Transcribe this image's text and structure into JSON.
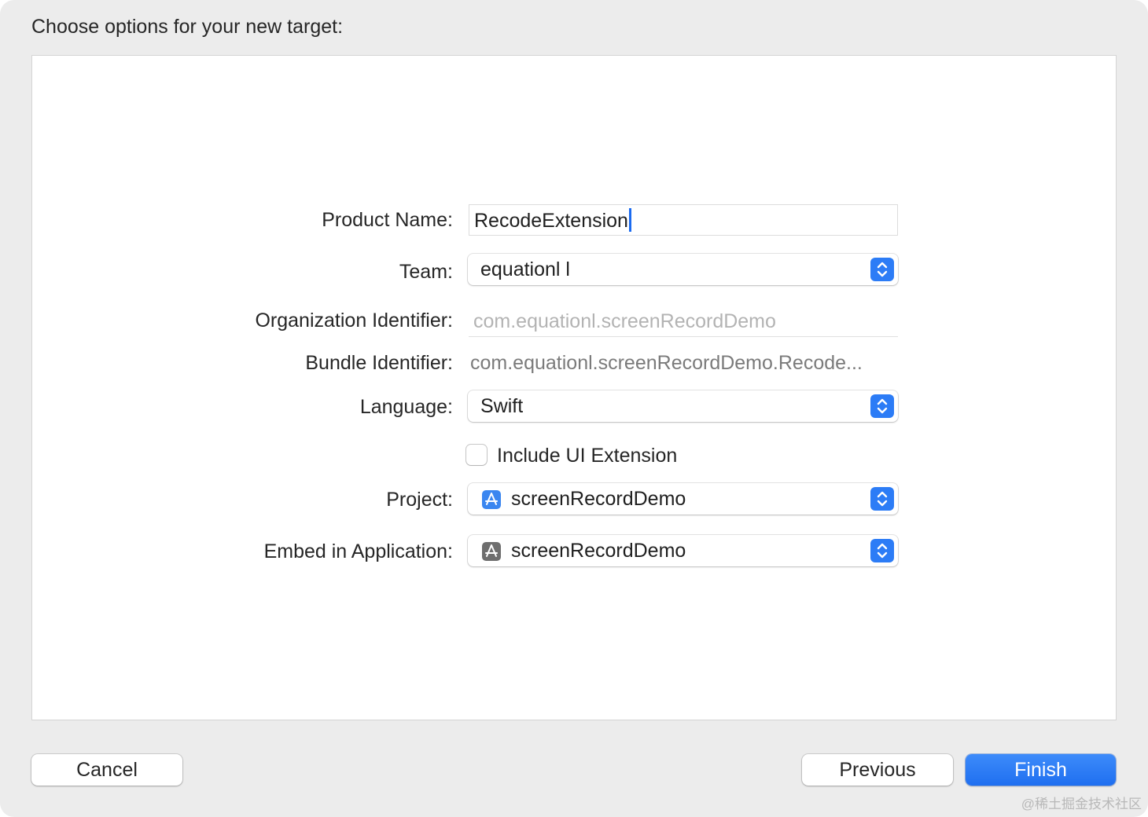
{
  "dialog": {
    "heading": "Choose options for your new target:"
  },
  "form": {
    "product_name": {
      "label": "Product Name:",
      "value": "RecodeExtension"
    },
    "team": {
      "label": "Team:",
      "value": "equationl l"
    },
    "organization_identifier": {
      "label": "Organization Identifier:",
      "value": "com.equationl.screenRecordDemo"
    },
    "bundle_identifier": {
      "label": "Bundle Identifier:",
      "value": "com.equationl.screenRecordDemo.Recode..."
    },
    "language": {
      "label": "Language:",
      "value": "Swift"
    },
    "include_ui_extension": {
      "label": "Include UI Extension",
      "checked": false
    },
    "project": {
      "label": "Project:",
      "value": "screenRecordDemo",
      "icon": "xcode-project-icon"
    },
    "embed_in_application": {
      "label": "Embed in Application:",
      "value": "screenRecordDemo",
      "icon": "app-icon"
    }
  },
  "footer": {
    "cancel_label": "Cancel",
    "previous_label": "Previous",
    "finish_label": "Finish"
  },
  "watermark": "@稀土掘金技术社区",
  "colors": {
    "accent": "#2c7cf6",
    "project_icon": "#3a86f0",
    "app_icon": "#6e6e6e"
  }
}
